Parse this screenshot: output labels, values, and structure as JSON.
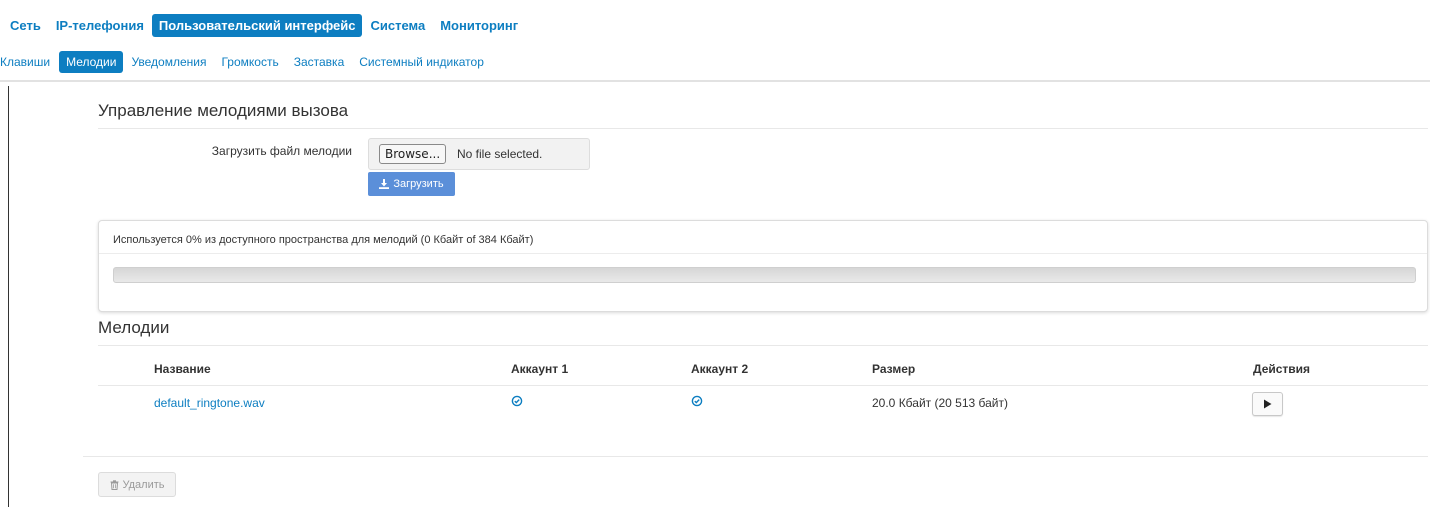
{
  "top_nav": {
    "items": [
      {
        "label": "Сеть"
      },
      {
        "label": "IP-телефония"
      },
      {
        "label": "Пользовательский интерфейс",
        "active": true
      },
      {
        "label": "Система"
      },
      {
        "label": "Мониторинг"
      }
    ]
  },
  "sub_nav": {
    "items": [
      {
        "label": "Клавиши"
      },
      {
        "label": "Мелодии",
        "active": true
      },
      {
        "label": "Уведомления"
      },
      {
        "label": "Громкость"
      },
      {
        "label": "Заставка"
      },
      {
        "label": "Системный индикатор"
      }
    ]
  },
  "ringtone_management": {
    "title": "Управление мелодиями вызова",
    "upload_label": "Загрузить файл мелодии",
    "browse_label": "Browse...",
    "no_file_text": "No file selected.",
    "upload_button_label": "Загрузить",
    "upload_icon": "download-icon"
  },
  "usage": {
    "text": "Используется 0% из доступного пространства для мелодий (0 Кбайт of 384 Кбайт)",
    "percent": 0
  },
  "melodies": {
    "title": "Мелодии",
    "columns": [
      "Название",
      "Аккаунт 1",
      "Аккаунт 2",
      "Размер",
      "Действия"
    ],
    "rows": [
      {
        "name": "default_ringtone.wav",
        "account1_icon": "check-circle-icon",
        "account2_icon": "check-circle-icon",
        "size": "20.0 Кбайт (20 513 байт)",
        "action_icon": "play-icon"
      }
    ]
  },
  "delete_button": {
    "label": "Удалить",
    "icon": "trash-icon"
  },
  "colors": {
    "accent": "#0d7ec1",
    "upload_button": "#5b8fd9",
    "text": "#333333"
  }
}
